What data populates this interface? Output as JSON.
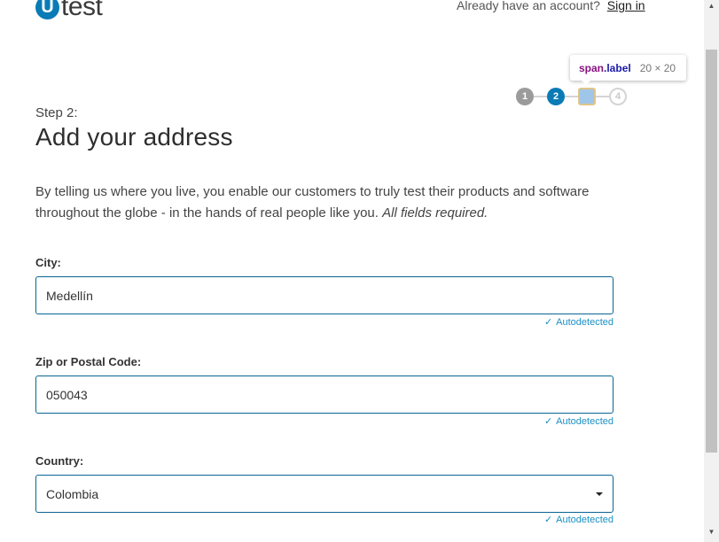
{
  "header": {
    "logo_letter": "U",
    "logo_text": "test",
    "account_prompt": "Already have an account?",
    "signin_label": "Sign in"
  },
  "steps": {
    "items": [
      "1",
      "2",
      "3",
      "4"
    ],
    "current": 2
  },
  "devtools_tooltip": {
    "tag": "span",
    "class_name": ".label",
    "dimensions": "20 × 20"
  },
  "main": {
    "step_label": "Step 2:",
    "title": "Add your address",
    "intro_text": "By telling us where you live, you enable our customers to truly test their products and software throughout the globe - in the hands of real people like you.",
    "intro_emphasis": "All fields required."
  },
  "form": {
    "city": {
      "label": "City:",
      "value": "Medellín",
      "status": "Autodetected"
    },
    "zip": {
      "label": "Zip or Postal Code:",
      "value": "050043",
      "status": "Autodetected"
    },
    "country": {
      "label": "Country:",
      "value": "Colombia",
      "status": "Autodetected"
    }
  },
  "colors": {
    "brand": "#0a7bb5",
    "field_border": "#0a6592",
    "autodetect": "#1a8fc4"
  }
}
